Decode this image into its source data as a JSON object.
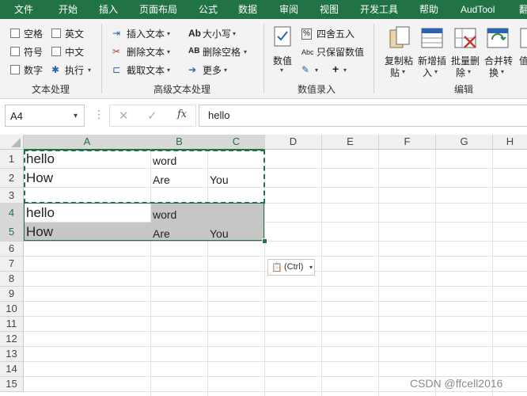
{
  "tabs": [
    "文件",
    "开始",
    "插入",
    "页面布局",
    "公式",
    "数据",
    "审阅",
    "视图",
    "开发工具",
    "帮助",
    "AudTool",
    "翻"
  ],
  "text_group": {
    "checks": [
      "空格",
      "英文",
      "符号",
      "中文",
      "数字"
    ],
    "exec_label": "执行",
    "group_label": "文本处理"
  },
  "adv_text": {
    "insert": "插入文本",
    "delete": "删除文本",
    "cut": "截取文本",
    "case": "大小写",
    "del_space": "删除空格",
    "more": "更多",
    "group_label": "高级文本处理"
  },
  "num_group": {
    "value": "数值",
    "round": "四舍五入",
    "keep_value": "只保留数值",
    "group_label": "数值录入"
  },
  "edit_group": {
    "copy_paste_1": "复制粘",
    "copy_paste_2": "贴",
    "new_insert_1": "新增插",
    "new_insert_2": "入",
    "batch_del_1": "批量删",
    "batch_del_2": "除",
    "merge_1": "合并转",
    "merge_2": "换",
    "last_1": "值",
    "group_label": "编辑"
  },
  "formula_bar": {
    "name_box": "A4",
    "fx": "fx",
    "content": "hello"
  },
  "columns": [
    "A",
    "B",
    "C",
    "D",
    "E",
    "F",
    "G",
    "H"
  ],
  "rows": [
    "1",
    "2",
    "3",
    "4",
    "5",
    "6",
    "7",
    "8",
    "9",
    "10",
    "11",
    "12",
    "13",
    "14",
    "15"
  ],
  "cells": {
    "a1": "hello",
    "b1": "word",
    "a2": "How",
    "b2": "Are",
    "c2": "You",
    "a4": "hello",
    "b4": "word",
    "a5": "How",
    "b5": "Are",
    "c5": "You"
  },
  "paste_options": "(Ctrl)",
  "watermark": "CSDN @ffcell2016",
  "colors": {
    "accent": "#217346",
    "selection": "#c6c6c6"
  }
}
